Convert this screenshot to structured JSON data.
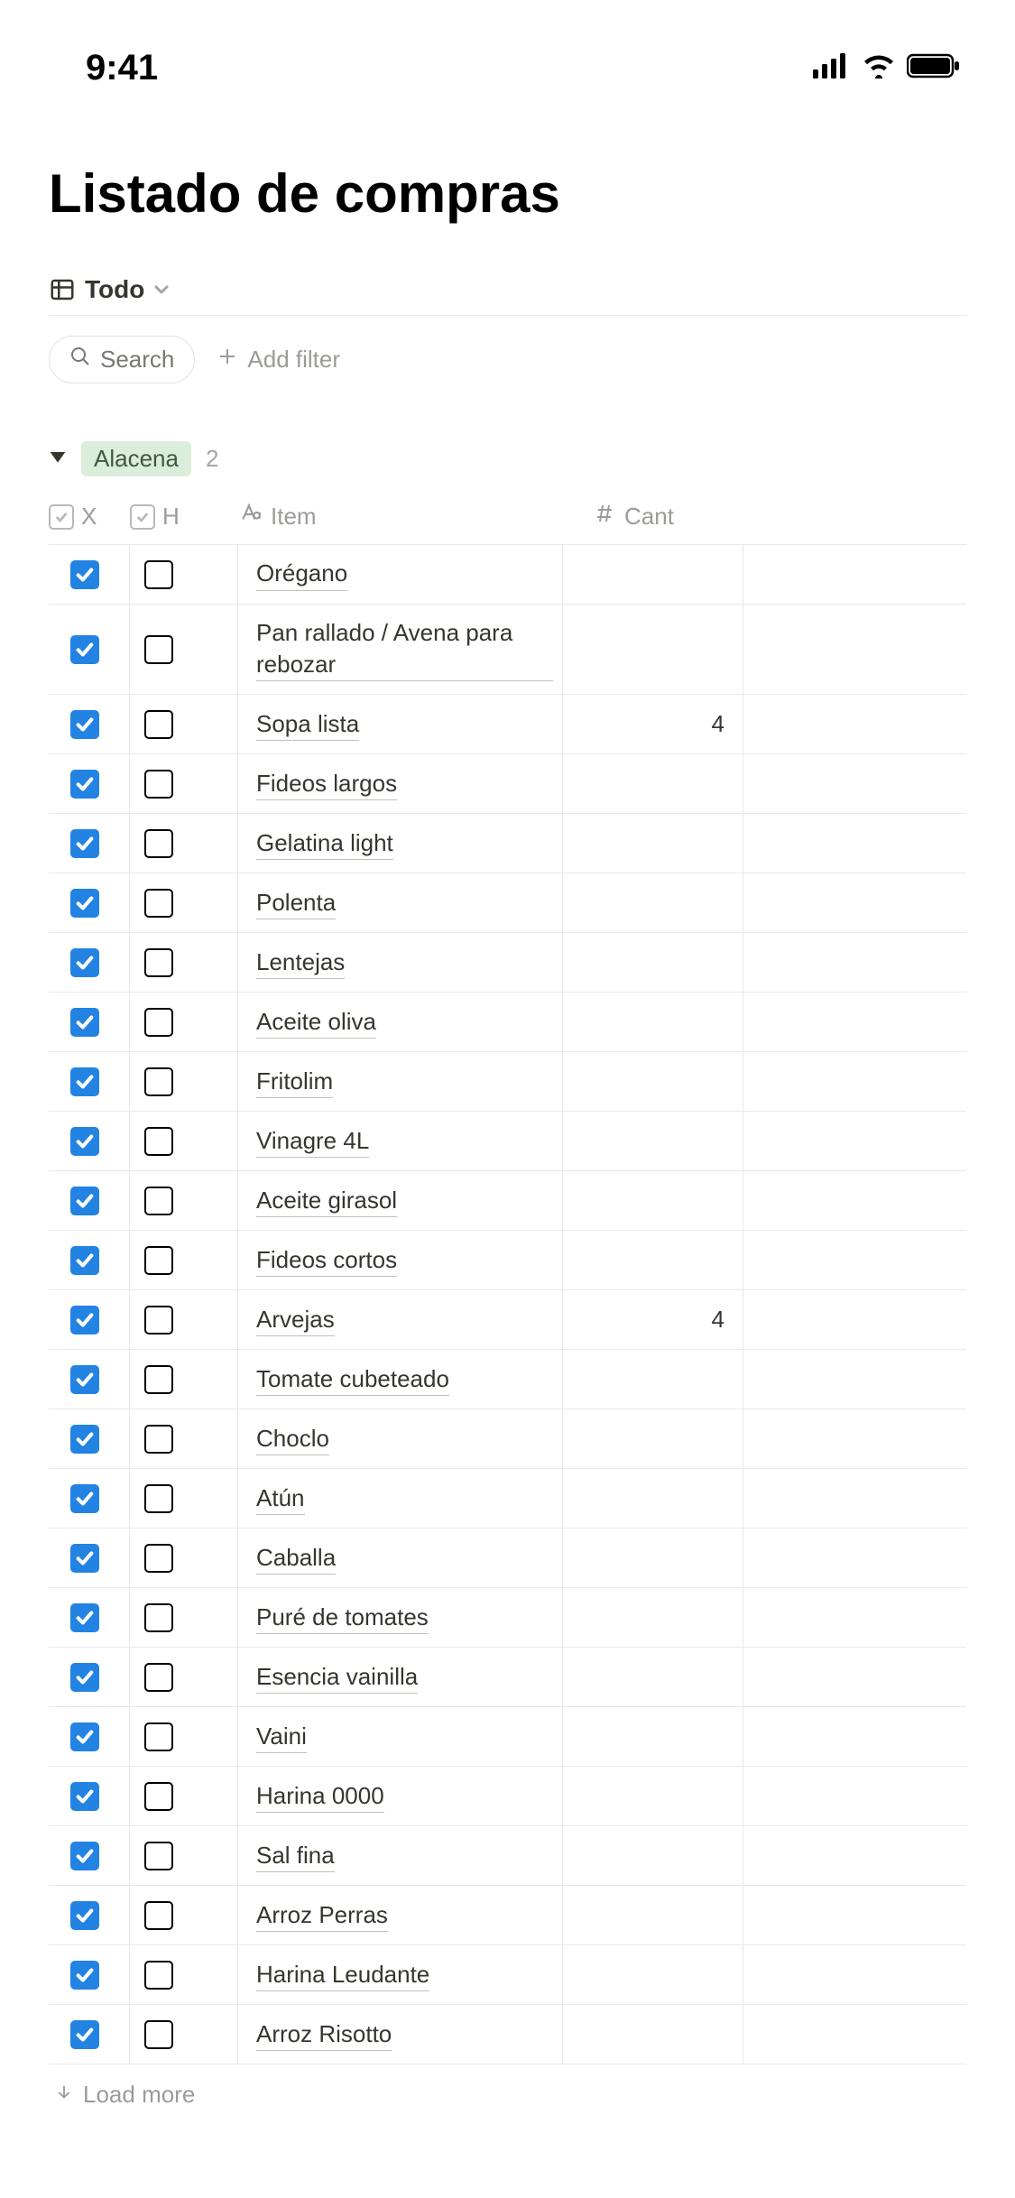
{
  "status_bar": {
    "time": "9:41"
  },
  "page": {
    "title": "Listado de compras",
    "view_name": "Todo",
    "search_label": "Search",
    "add_filter_label": "Add filter",
    "load_more_label": "Load more"
  },
  "group": {
    "name": "Alacena",
    "count": "2"
  },
  "columns": {
    "x": "X",
    "h": "H",
    "item": "Item",
    "cant": "Cant"
  },
  "rows": [
    {
      "x": true,
      "h": false,
      "item": "Orégano",
      "cant": ""
    },
    {
      "x": true,
      "h": false,
      "item": "Pan rallado / Avena para rebozar",
      "cant": ""
    },
    {
      "x": true,
      "h": false,
      "item": "Sopa lista",
      "cant": "4"
    },
    {
      "x": true,
      "h": false,
      "item": "Fideos largos",
      "cant": ""
    },
    {
      "x": true,
      "h": false,
      "item": "Gelatina light",
      "cant": ""
    },
    {
      "x": true,
      "h": false,
      "item": "Polenta",
      "cant": ""
    },
    {
      "x": true,
      "h": false,
      "item": "Lentejas",
      "cant": ""
    },
    {
      "x": true,
      "h": false,
      "item": "Aceite oliva",
      "cant": ""
    },
    {
      "x": true,
      "h": false,
      "item": "Fritolim",
      "cant": ""
    },
    {
      "x": true,
      "h": false,
      "item": "Vinagre 4L",
      "cant": ""
    },
    {
      "x": true,
      "h": false,
      "item": "Aceite girasol",
      "cant": ""
    },
    {
      "x": true,
      "h": false,
      "item": "Fideos cortos",
      "cant": ""
    },
    {
      "x": true,
      "h": false,
      "item": "Arvejas",
      "cant": "4"
    },
    {
      "x": true,
      "h": false,
      "item": "Tomate cubeteado",
      "cant": ""
    },
    {
      "x": true,
      "h": false,
      "item": "Choclo",
      "cant": ""
    },
    {
      "x": true,
      "h": false,
      "item": "Atún",
      "cant": ""
    },
    {
      "x": true,
      "h": false,
      "item": "Caballa",
      "cant": ""
    },
    {
      "x": true,
      "h": false,
      "item": "Puré de tomates",
      "cant": ""
    },
    {
      "x": true,
      "h": false,
      "item": "Esencia vainilla",
      "cant": ""
    },
    {
      "x": true,
      "h": false,
      "item": "Vaini",
      "cant": ""
    },
    {
      "x": true,
      "h": false,
      "item": "Harina 0000",
      "cant": ""
    },
    {
      "x": true,
      "h": false,
      "item": "Sal fina",
      "cant": ""
    },
    {
      "x": true,
      "h": false,
      "item": "Arroz Perras",
      "cant": ""
    },
    {
      "x": true,
      "h": false,
      "item": "Harina Leudante",
      "cant": ""
    },
    {
      "x": true,
      "h": false,
      "item": "Arroz Risotto",
      "cant": ""
    }
  ]
}
